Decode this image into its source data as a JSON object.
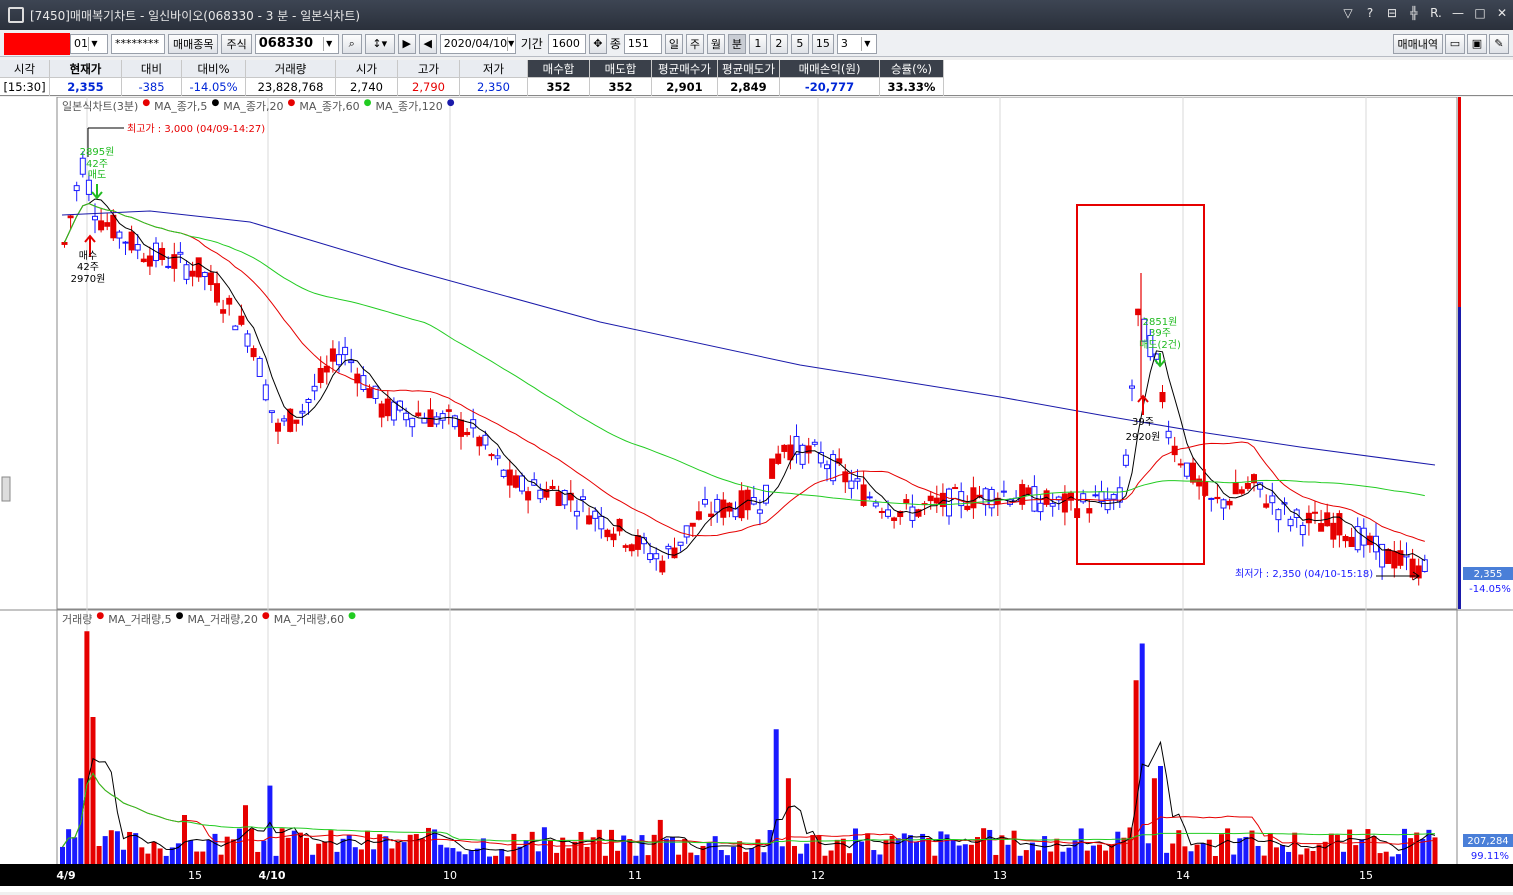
{
  "window": {
    "title": "[7450]매매복기차트 - 일신바이오(068330 - 3 분 - 일본식차트)",
    "controls": [
      "▽",
      "?",
      "⊟",
      "╬",
      "R.",
      "—",
      "□",
      "✕"
    ]
  },
  "toolbar": {
    "account_suffix": "01",
    "password_mask": "********",
    "trade_items_button": "매매종목",
    "market_type": "주식",
    "stock_code": "068330",
    "date": "2020/04/10",
    "period_label": "기간",
    "period_value": "1600",
    "count_label": "종",
    "count_value": "151",
    "timeframes": [
      "일",
      "주",
      "월",
      "분",
      "1",
      "2",
      "5",
      "15",
      "3"
    ],
    "history_button": "매매내역"
  },
  "quote": {
    "headers": [
      "시각",
      "현재가",
      "대비",
      "대비%",
      "거래량",
      "시가",
      "고가",
      "저가",
      "매수합",
      "매도합",
      "평균매수가",
      "평균매도가",
      "매매손익(원)",
      "승률(%)"
    ],
    "values": [
      "[15:30]",
      "2,355",
      "-385",
      "-14.05%",
      "23,828,768",
      "2,740",
      "2,790",
      "2,350",
      "352",
      "352",
      "2,901",
      "2,849",
      "-20,777",
      "33.33%"
    ],
    "colors": {
      "up": "#e60000",
      "down": "#0026d6"
    }
  },
  "price_legend": {
    "series": "일본식차트(3분)",
    "ma": [
      "MA_종가,5",
      "MA_종가,20",
      "MA_종가,60",
      "MA_종가,120"
    ]
  },
  "volume_legend": {
    "series": "거래량",
    "ma": [
      "MA_거래량,5",
      "MA_거래량,20",
      "MA_거래량,60"
    ]
  },
  "annotations": {
    "high": "최고가 : 3,000 (04/09-14:27)",
    "low": "최저가 : 2,350 (04/10-15:18)",
    "sell1": [
      "2895원",
      "42주",
      "매도"
    ],
    "buy1": [
      "매수",
      "42주",
      "2970원"
    ],
    "sell2": [
      "2851원",
      "39주",
      "매도(2건)"
    ],
    "buy2": [
      "39주",
      "2920원"
    ],
    "current_price_tag": "2,355",
    "current_pct_tag": "-14.05%",
    "volume_tag": "207,284",
    "volume_pct_tag": "99.11%"
  },
  "x_axis_labels": [
    "4/9",
    "15",
    "4/10",
    "10",
    "11",
    "12",
    "13",
    "14",
    "15"
  ],
  "chart_data": {
    "type": "candlestick",
    "timeframe": "3분",
    "ylim_price": [
      2350,
      3000
    ],
    "high": 3000,
    "low": 2350,
    "close": 2355
  },
  "colors": {
    "up": "#e60000",
    "down": "#1a1aff",
    "ma5": "#000000",
    "ma20": "#e60000",
    "ma60": "#22cc22",
    "ma120": "#1a1aaa",
    "highlight": "#e60000"
  }
}
